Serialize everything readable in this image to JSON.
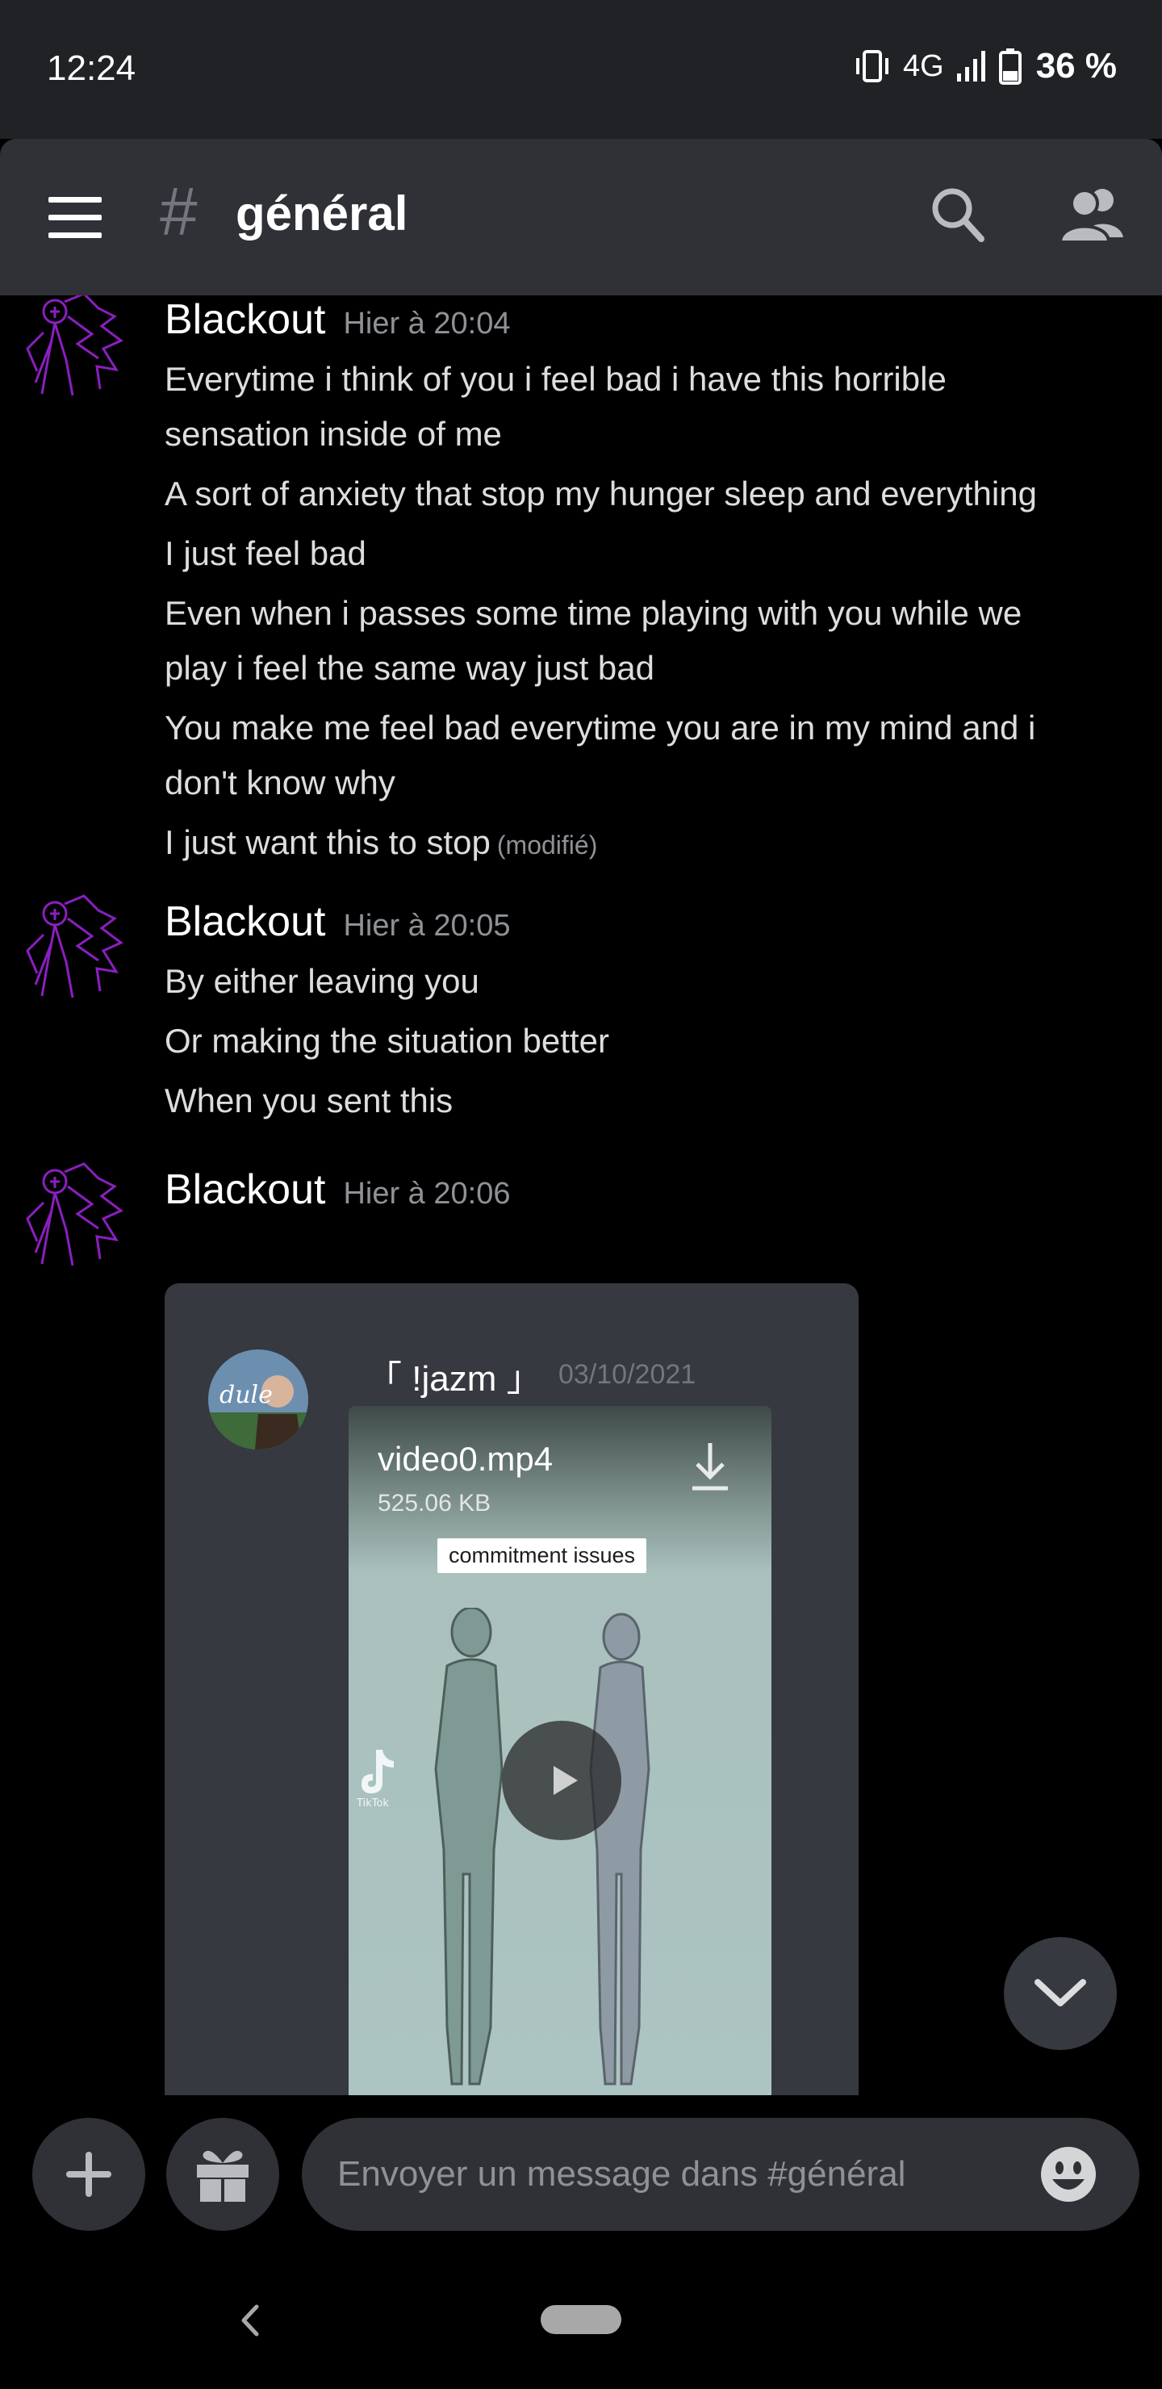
{
  "status_bar": {
    "time": "12:24",
    "network": "4G",
    "battery": "36 %",
    "battery_level_pct": 36
  },
  "header": {
    "channel_name": "général",
    "icons": [
      "menu-icon",
      "hash-icon",
      "search-icon",
      "members-icon"
    ]
  },
  "messages": [
    {
      "author": "Blackout",
      "timestamp": "Hier à 20:04",
      "lines": [
        "Everytime i think of you i feel bad i have this horrible",
        "sensation inside of me",
        "A sort of anxiety that stop my hunger sleep and everything",
        "I just feel bad",
        "Even when i passes some time playing with you while we",
        "play i feel the same way just bad",
        "You make me feel bad everytime you are in my mind and i",
        "don't know why",
        "I just want this to stop"
      ],
      "edited_label": "(modifié)"
    },
    {
      "author": "Blackout",
      "timestamp": "Hier à 20:05",
      "lines": [
        "By either leaving you",
        "Or making the situation better",
        "When you sent this"
      ]
    },
    {
      "author": "Blackout",
      "timestamp": "Hier à 20:06",
      "embed": {
        "username": "「 !jazm 」",
        "date": "03/10/2021",
        "file_name": "video0.mp4",
        "file_size": "525.06 KB",
        "caption": "commitment issues",
        "watermark": "TikTok"
      }
    }
  ],
  "composer": {
    "placeholder": "Envoyer un message dans #général"
  },
  "colors": {
    "status_bar_bg": "#202225",
    "header_bg": "#2f3136",
    "chat_bg": "#000000",
    "avatar_accent": "#8a1fbf",
    "timestamp": "#8e9297"
  }
}
